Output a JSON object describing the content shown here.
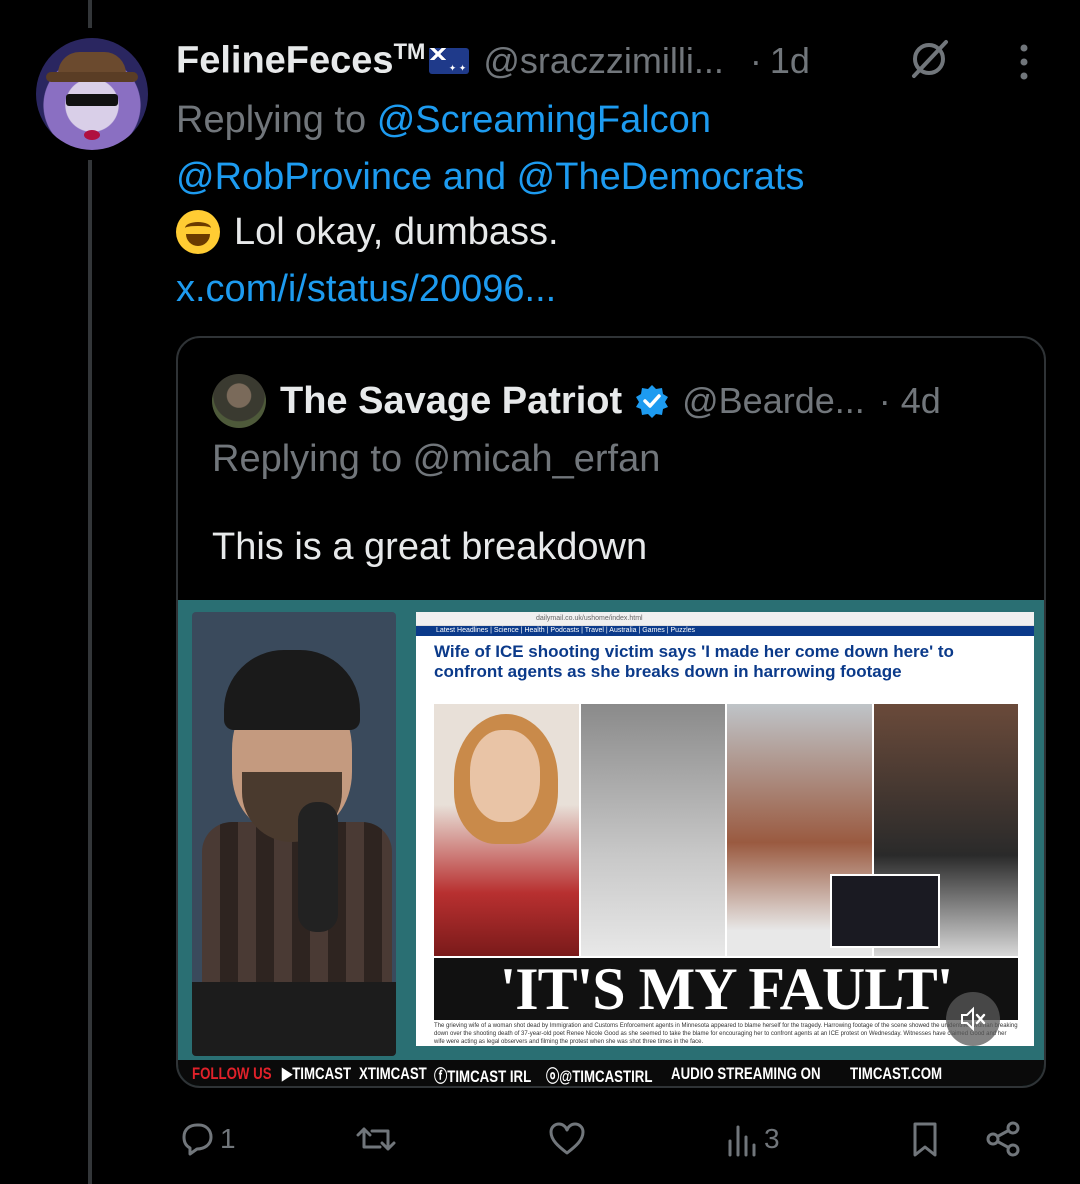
{
  "tweet": {
    "display_name": "FelineFeces",
    "tm": "TM",
    "handle": "@sraczzimilli...",
    "separator": "·",
    "time": "1d",
    "replying_prefix": "Replying to",
    "mention_1": "@ScreamingFalcon",
    "mention_2": "@RobProvince",
    "and": "and",
    "mention_3": "@TheDemocrats",
    "text": "Lol okay, dumbass.",
    "link": "x.com/i/status/20096..."
  },
  "quote": {
    "display_name": "The Savage Patriot",
    "handle": "@Bearde...",
    "time": "· 4d",
    "replying": "Replying to @micah_erfan",
    "text": "This is a great breakdown",
    "media": {
      "browser_url": "dailymail.co.uk/ushome/index.html",
      "nav": "Latest Headlines | Science | Health | Podcasts | Travel | Australia | Games | Puzzles",
      "headline": "Wife of ICE shooting victim says 'I made her come down here' to confront agents as she breaks down in harrowing footage",
      "big_quote": "'IT'S MY FAULT'",
      "caption": "The grieving wife of a woman shot dead by Immigration and Customs Enforcement agents in Minnesota appeared to blame herself for the tragedy. Harrowing footage of the scene showed the unidentified woman breaking down over the shooting death of 37-year-old poet Renee Nicole Good as she seemed to take the blame for encouraging her to confront agents at an ICE protest on Wednesday. Witnesses have claimed Good and her wife were acting as legal observers and filming the protest when she was shot three times in the face.",
      "ticker": {
        "follow": "FOLLOW US",
        "t1": "▶TIMCAST",
        "t2": "XTIMCAST",
        "t3": "ⓕTIMCAST IRL",
        "t4": "ⓞ@TIMCASTIRL",
        "t5": "AUDIO STREAMING ON",
        "t6": "TIMCAST.COM"
      }
    }
  },
  "actions": {
    "replies": "1",
    "views": "3"
  },
  "colors": {
    "background": "#000000",
    "accent": "#1d9bf0",
    "muted": "#71767b",
    "text": "#e7e9ea"
  },
  "icons": [
    "grok-icon",
    "more-icon",
    "verified-badge-icon",
    "mute-icon",
    "reply-icon",
    "retweet-icon",
    "like-icon",
    "views-icon",
    "bookmark-icon",
    "share-icon",
    "laughing-emoji-icon",
    "australia-flag-icon"
  ]
}
